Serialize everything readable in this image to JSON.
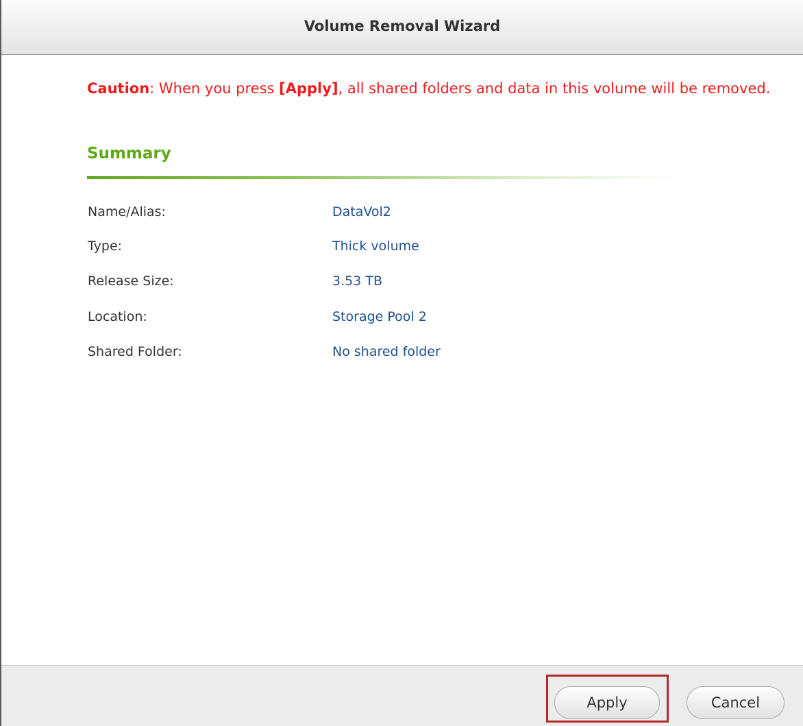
{
  "dialog": {
    "title": "Volume Removal Wizard"
  },
  "caution": {
    "prefix": "Caution",
    "text1": ": When you press ",
    "apply_ref": "[Apply]",
    "text2": ", all shared folders and data in this volume will be removed."
  },
  "summary": {
    "heading": "Summary",
    "rows": [
      {
        "label": "Name/Alias:",
        "value": "DataVol2"
      },
      {
        "label": "Type:",
        "value": "Thick volume"
      },
      {
        "label": "Release Size:",
        "value": "3.53 TB"
      },
      {
        "label": "Location:",
        "value": "Storage Pool 2"
      },
      {
        "label": "Shared Folder:",
        "value": "No shared folder"
      }
    ]
  },
  "buttons": {
    "apply_label": "Apply",
    "cancel_label": "Cancel"
  },
  "colors": {
    "caution": "#ee1c1c",
    "summary_heading": "#5fa817",
    "value_text": "#1f4f92",
    "highlight_border": "#b32a2a"
  }
}
